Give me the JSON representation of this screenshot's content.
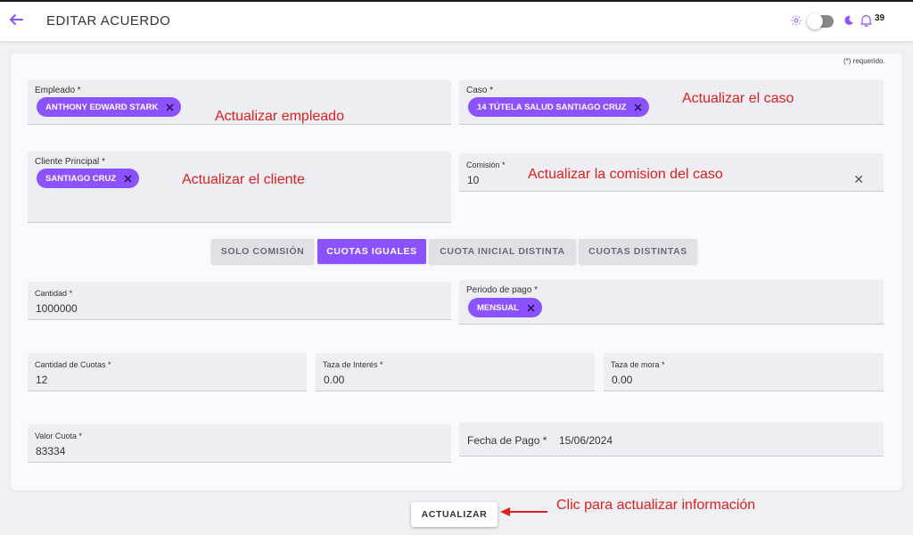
{
  "header": {
    "title": "EDITAR ACUERDO",
    "notification_count": "39"
  },
  "form": {
    "required_note": "(*) requerido.",
    "empleado": {
      "label": "Empleado *",
      "chip": "ANTHONY EDWARD STARK"
    },
    "caso": {
      "label": "Caso *",
      "chip": "14 TÚTELA SALUD SANTIAGO CRUZ"
    },
    "cliente": {
      "label": "Cliente Principal *",
      "chip": "SANTIAGO CRUZ"
    },
    "comision": {
      "label": "Comisión *",
      "value": "10"
    },
    "tabs": [
      {
        "label": "SOLO COMISIÓN",
        "active": false
      },
      {
        "label": "CUOTAS IGUALES",
        "active": true
      },
      {
        "label": "CUOTA INICIAL DISTINTA",
        "active": false
      },
      {
        "label": "CUOTAS DISTINTAS",
        "active": false
      }
    ],
    "cantidad": {
      "label": "Cantidad *",
      "value": "1000000"
    },
    "periodo": {
      "label": "Periodo de pago *",
      "chip": "MENSUAL"
    },
    "cantidad_cuotas": {
      "label": "Cantidad de Cuotas *",
      "value": "12"
    },
    "tasa_interes": {
      "label": "Taza de Interés *",
      "value": "0.00"
    },
    "tasa_mora": {
      "label": "Taza de mora *",
      "value": "0.00"
    },
    "valor_cuota": {
      "label": "Valor Cuota *",
      "value": "83334"
    },
    "fecha_pago": {
      "label": "Fecha de Pago *",
      "value": "15/06/2024"
    },
    "submit_label": "ACTUALIZAR"
  },
  "annotations": {
    "empleado": "Actualizar empleado",
    "caso": "Actualizar el caso",
    "cliente": "Actualizar el cliente",
    "comision": "Actualizar la comision del caso",
    "submit": "Clic para actualizar información"
  },
  "colors": {
    "accent": "#8c52ff",
    "annotation": "#e0201a",
    "field_bg": "#eceef4"
  },
  "icons": {
    "back": "arrow-left-icon",
    "sun": "sun-icon",
    "moon": "moon-icon",
    "bell": "bell-icon",
    "chip_remove": "close-icon"
  }
}
